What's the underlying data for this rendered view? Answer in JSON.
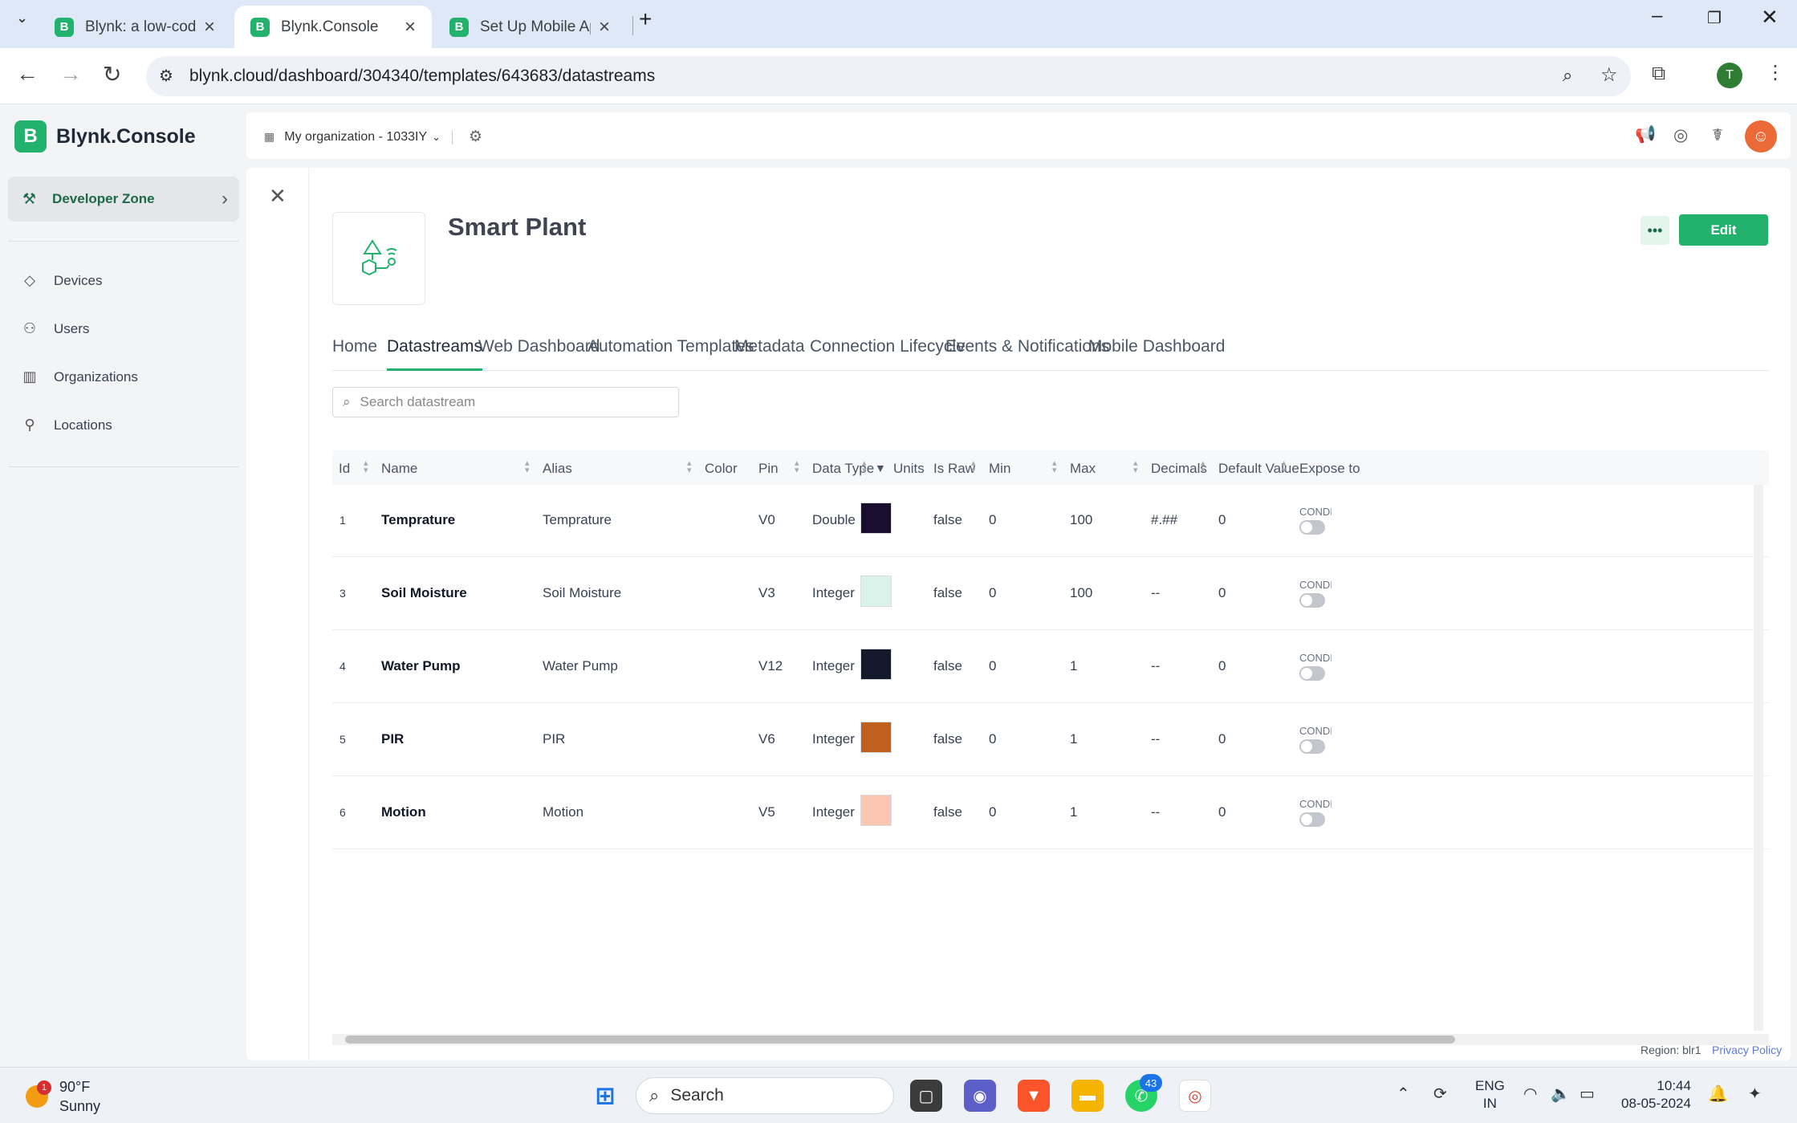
{
  "browser": {
    "tabs": [
      {
        "title": "Blynk: a low-code IoT software"
      },
      {
        "title": "Blynk.Console"
      },
      {
        "title": "Set Up Mobile App Dashboard"
      }
    ],
    "url": "blynk.cloud/dashboard/304340/templates/643683/datastreams",
    "profile_initial": "T"
  },
  "sidebar": {
    "brand": "Blynk.Console",
    "brand_logo": "B",
    "developer_zone": "Developer Zone",
    "items": [
      {
        "label": "Devices",
        "icon": "cube-icon"
      },
      {
        "label": "Users",
        "icon": "users-icon"
      },
      {
        "label": "Organizations",
        "icon": "building-icon"
      },
      {
        "label": "Locations",
        "icon": "pin-icon"
      }
    ]
  },
  "topbar": {
    "organization": "My organization - 1033IY"
  },
  "template": {
    "title": "Smart Plant",
    "edit_label": "Edit",
    "tabs": [
      "Home",
      "Datastreams",
      "Web Dashboard",
      "Automation Templates",
      "Metadata",
      "Connection Lifecycle",
      "Events & Notifications",
      "Mobile Dashboard"
    ],
    "active_tab": "Datastreams"
  },
  "search": {
    "placeholder": "Search datastream"
  },
  "table": {
    "columns": [
      "Id",
      "Name",
      "Alias",
      "Color",
      "Pin",
      "Data Type",
      "Units",
      "Is Raw",
      "Min",
      "Max",
      "Decimals",
      "Default Value",
      "Expose to"
    ],
    "rows": [
      {
        "id": "1",
        "name": "Temprature",
        "alias": "Temprature",
        "color": "#1a0d2e",
        "pin": "V0",
        "data_type": "Double",
        "units": "",
        "is_raw": "false",
        "min": "0",
        "max": "100",
        "decimals": "#.##",
        "default": "0",
        "expose": "CONDIT"
      },
      {
        "id": "3",
        "name": "Soil Moisture",
        "alias": "Soil Moisture",
        "color": "#daf3ea",
        "pin": "V3",
        "data_type": "Integer",
        "units": "",
        "is_raw": "false",
        "min": "0",
        "max": "100",
        "decimals": "--",
        "default": "0",
        "expose": "CONDIT"
      },
      {
        "id": "4",
        "name": "Water Pump",
        "alias": "Water Pump",
        "color": "#141a2c",
        "pin": "V12",
        "data_type": "Integer",
        "units": "",
        "is_raw": "false",
        "min": "0",
        "max": "1",
        "decimals": "--",
        "default": "0",
        "expose": "CONDIT"
      },
      {
        "id": "5",
        "name": "PIR",
        "alias": "PIR",
        "color": "#c0601f",
        "pin": "V6",
        "data_type": "Integer",
        "units": "",
        "is_raw": "false",
        "min": "0",
        "max": "1",
        "decimals": "--",
        "default": "0",
        "expose": "CONDIT"
      },
      {
        "id": "6",
        "name": "Motion",
        "alias": "Motion",
        "color": "#fbc7b3",
        "pin": "V5",
        "data_type": "Integer",
        "units": "",
        "is_raw": "false",
        "min": "0",
        "max": "1",
        "decimals": "--",
        "default": "0",
        "expose": "CONDIT"
      }
    ]
  },
  "footer": {
    "region": "Region: blr1",
    "privacy": "Privacy Policy"
  },
  "taskbar": {
    "temperature": "90°F",
    "condition": "Sunny",
    "weather_badge": "1",
    "search": "Search",
    "whatsapp_badge": "43",
    "lang_1": "ENG",
    "lang_2": "IN",
    "time": "10:44",
    "date": "08-05-2024"
  },
  "colors": {
    "accent": "#23b26d",
    "brand_dark": "#1d6a48"
  }
}
